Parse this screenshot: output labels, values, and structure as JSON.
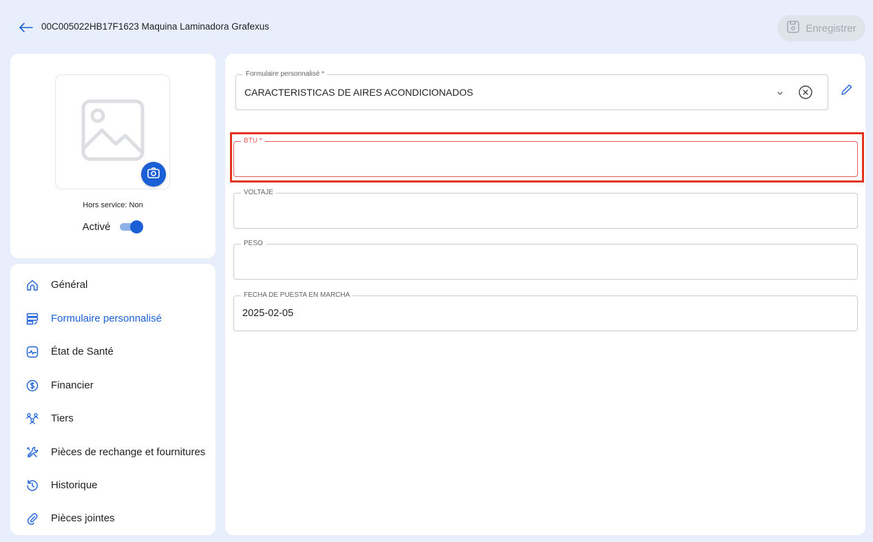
{
  "header": {
    "title": "00C005022HB17F1623 Maquina Laminadora Grafexus",
    "save_label": "Enregistrer"
  },
  "profile": {
    "out_of_service": "Hors service: Non",
    "active_label": "Activé",
    "active": true
  },
  "nav": {
    "items": [
      {
        "label": "Général",
        "icon": "home-icon"
      },
      {
        "label": "Formulaire personnalisé",
        "icon": "form-icon",
        "active": true
      },
      {
        "label": "État de Santé",
        "icon": "health-icon"
      },
      {
        "label": "Financier",
        "icon": "dollar-icon"
      },
      {
        "label": "Tiers",
        "icon": "people-icon"
      },
      {
        "label": "Pièces de rechange et fournitures",
        "icon": "tools-icon"
      },
      {
        "label": "Historique",
        "icon": "history-icon"
      },
      {
        "label": "Pièces jointes",
        "icon": "attachment-icon"
      }
    ]
  },
  "form": {
    "selector_label": "Formulaire personnalisé *",
    "selector_value": "CARACTERISTICAS DE AIRES ACONDICIONADOS",
    "fields": [
      {
        "label": "BTU *",
        "value": ""
      },
      {
        "label": "VOLTAJE",
        "value": ""
      },
      {
        "label": "PESO",
        "value": ""
      },
      {
        "label": "FECHA DE PUESTA EN MARCHA",
        "value": "2025-02-05"
      }
    ]
  },
  "colors": {
    "accent": "#1a5fd6",
    "background": "#e8eefb",
    "error": "#e45b5b",
    "highlight": "#e2351f"
  }
}
